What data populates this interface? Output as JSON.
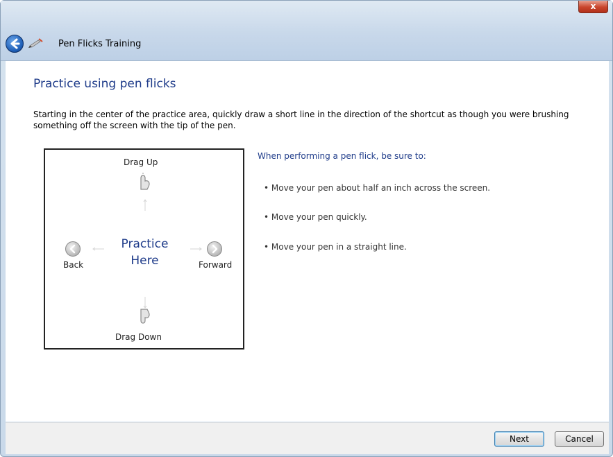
{
  "window": {
    "title": "Pen Flicks Training",
    "close_glyph": "x"
  },
  "page": {
    "title": "Practice using pen flicks",
    "instruction": "Starting in the center of the practice area, quickly draw a short line in the direction of the shortcut as though you were brushing something off the screen with the tip of the pen."
  },
  "practice_area": {
    "drag_up": "Drag Up",
    "drag_down": "Drag Down",
    "back": "Back",
    "forward": "Forward",
    "center_line1": "Practice",
    "center_line2": "Here"
  },
  "tips": {
    "heading": "When performing a pen flick, be sure to:",
    "items": [
      "• Move your pen about half an inch across the screen.",
      "• Move your pen quickly.",
      "• Move your pen in a straight line."
    ]
  },
  "footer": {
    "next_label": "Next",
    "cancel_label": "Cancel"
  },
  "icons": {
    "back": "back-arrow-icon",
    "app": "pen-icon",
    "flick_up": "hand-up-icon",
    "flick_down": "hand-down-icon",
    "flick_left": "left-arrow-icon",
    "flick_right": "right-arrow-icon"
  },
  "colors": {
    "heading_blue": "#1f3c8a",
    "close_red": "#c9452c"
  }
}
